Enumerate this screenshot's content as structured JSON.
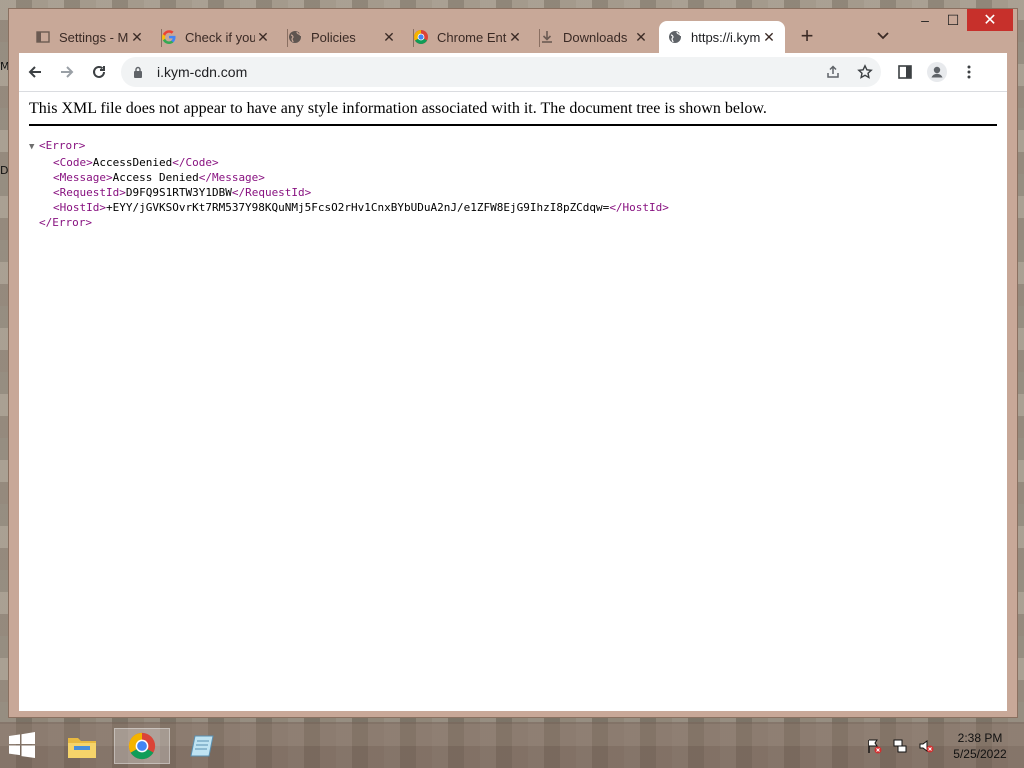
{
  "desktop": {
    "edge_letters": [
      "M",
      "D"
    ]
  },
  "tabs": [
    {
      "title": "Settings - M",
      "icon": "settings-page-icon"
    },
    {
      "title": "Check if you",
      "icon": "google-g-icon"
    },
    {
      "title": "Policies",
      "icon": "globe-icon"
    },
    {
      "title": "Chrome Ent",
      "icon": "chrome-icon"
    },
    {
      "title": "Downloads",
      "icon": "download-icon"
    },
    {
      "title": "https://i.kym",
      "icon": "globe-icon",
      "active": true
    }
  ],
  "tab_close_glyph": "✕",
  "new_tab_glyph": "+",
  "window_controls": {
    "minimize": "–",
    "maximize": "☐",
    "close": "✕"
  },
  "address_bar": {
    "url": "i.kym-cdn.com"
  },
  "page": {
    "notice": "This XML file does not appear to have any style information associated with it. The document tree is shown below.",
    "xml": {
      "root_open": "<Error>",
      "code_open": "<Code>",
      "code_value": "AccessDenied",
      "code_close": "</Code>",
      "message_open": "<Message>",
      "message_value": "Access Denied",
      "message_close": "</Message>",
      "requestid_open": "<RequestId>",
      "requestid_value": "D9FQ9S1RTW3Y1DBW",
      "requestid_close": "</RequestId>",
      "hostid_open": "<HostId>",
      "hostid_value": "+EYY/jGVKSOvrKt7RM537Y98KQuNMj5FcsO2rHv1CnxBYbUDuA2nJ/e1ZFW8EjG9IhzI8pZCdqw=",
      "hostid_close": "</HostId>",
      "root_close": "</Error>"
    }
  },
  "taskbar": {
    "apps": [
      "file-explorer-icon",
      "chrome-icon",
      "notepad-icon"
    ],
    "clock": {
      "time": "2:38 PM",
      "date": "5/25/2022"
    }
  },
  "colors": {
    "xml_tag": "#881280",
    "close_button": "#c7302b",
    "tab_strip": "#c8a898"
  }
}
